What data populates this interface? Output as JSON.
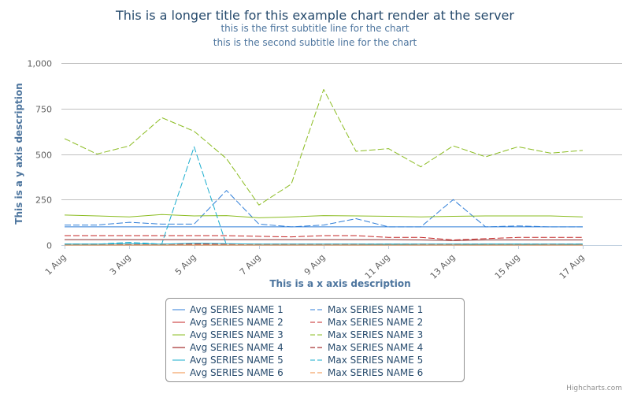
{
  "chart_data": {
    "type": "line",
    "title": "This is a longer title for this example chart render at the server",
    "subtitles": [
      "this is the first subtitle line for the chart",
      "this is the second subtitle line for the chart"
    ],
    "xlabel": "This is a x axis description",
    "ylabel": "This is a y axis description",
    "x": [
      "1 Aug",
      "2 Aug",
      "3 Aug",
      "4 Aug",
      "5 Aug",
      "6 Aug",
      "7 Aug",
      "8 Aug",
      "9 Aug",
      "10 Aug",
      "11 Aug",
      "12 Aug",
      "13 Aug",
      "14 Aug",
      "15 Aug",
      "16 Aug",
      "17 Aug"
    ],
    "x_tick_labels": [
      "1 Aug",
      "3 Aug",
      "5 Aug",
      "7 Aug",
      "9 Aug",
      "11 Aug",
      "13 Aug",
      "15 Aug",
      "17 Aug"
    ],
    "ylim": [
      0,
      1000
    ],
    "y_ticks": [
      0,
      250,
      500,
      750,
      1000
    ],
    "y_tick_labels": [
      "0",
      "250",
      "500",
      "750",
      "1,000"
    ],
    "grid": true,
    "legend_position": "bottom",
    "series": [
      {
        "name": "Avg SERIES NAME 1",
        "color": "#2f7ed8",
        "dash": false,
        "values": [
          100,
          100,
          100,
          100,
          100,
          100,
          100,
          100,
          100,
          100,
          100,
          100,
          100,
          100,
          100,
          100,
          100
        ]
      },
      {
        "name": "Max SERIES NAME 1",
        "color": "#2f7ed8",
        "dash": true,
        "values": [
          110,
          110,
          125,
          115,
          115,
          300,
          115,
          100,
          110,
          145,
          100,
          100,
          250,
          100,
          105,
          100,
          100
        ]
      },
      {
        "name": "Avg SERIES NAME 2",
        "color": "#8b2e2e",
        "dash": false,
        "values": [
          30,
          30,
          30,
          30,
          30,
          30,
          30,
          30,
          30,
          30,
          30,
          28,
          25,
          28,
          28,
          28,
          28
        ]
      },
      {
        "name": "Max SERIES NAME 2",
        "color": "#c42525",
        "dash": true,
        "values": [
          52,
          52,
          52,
          52,
          52,
          52,
          48,
          45,
          52,
          52,
          42,
          42,
          28,
          35,
          42,
          42,
          42
        ]
      },
      {
        "name": "Avg SERIES NAME 3",
        "color": "#8bbc21",
        "dash": false,
        "values": [
          165,
          160,
          155,
          168,
          160,
          162,
          150,
          155,
          162,
          160,
          158,
          155,
          158,
          160,
          160,
          160,
          155
        ]
      },
      {
        "name": "Max SERIES NAME 3",
        "color": "#8bbc21",
        "dash": true,
        "values": [
          585,
          500,
          545,
          700,
          625,
          475,
          220,
          335,
          855,
          515,
          530,
          430,
          545,
          485,
          540,
          505,
          520
        ]
      },
      {
        "name": "Avg SERIES NAME 4",
        "color": "#910000",
        "dash": false,
        "values": [
          0,
          0,
          0,
          0,
          0,
          0,
          0,
          0,
          0,
          0,
          0,
          0,
          0,
          0,
          0,
          0,
          0
        ]
      },
      {
        "name": "Max SERIES NAME 4",
        "color": "#910000",
        "dash": true,
        "values": [
          5,
          5,
          5,
          5,
          5,
          5,
          5,
          5,
          5,
          5,
          5,
          5,
          5,
          5,
          5,
          5,
          5
        ]
      },
      {
        "name": "Avg SERIES NAME 5",
        "color": "#1aadce",
        "dash": false,
        "values": [
          5,
          5,
          8,
          5,
          10,
          8,
          5,
          5,
          5,
          5,
          5,
          5,
          5,
          5,
          5,
          5,
          5
        ]
      },
      {
        "name": "Max SERIES NAME 5",
        "color": "#1aadce",
        "dash": true,
        "values": [
          5,
          5,
          15,
          5,
          540,
          0,
          0,
          0,
          0,
          0,
          5,
          0,
          0,
          5,
          5,
          0,
          5
        ]
      },
      {
        "name": "Avg SERIES NAME 6",
        "color": "#f28f43",
        "dash": false,
        "values": [
          0,
          0,
          0,
          0,
          0,
          0,
          0,
          0,
          0,
          0,
          0,
          0,
          0,
          0,
          0,
          0,
          0
        ]
      },
      {
        "name": "Max SERIES NAME 6",
        "color": "#f28f43",
        "dash": true,
        "values": [
          0,
          0,
          0,
          0,
          0,
          0,
          0,
          0,
          0,
          0,
          0,
          0,
          0,
          0,
          0,
          0,
          0
        ]
      }
    ],
    "legend_items": [
      {
        "name": "Avg SERIES NAME 1",
        "color": "#2f7ed8",
        "dash": false
      },
      {
        "name": "Max SERIES NAME 1",
        "color": "#2f7ed8",
        "dash": true
      },
      {
        "name": "Avg SERIES NAME 2",
        "color": "#c42525",
        "dash": false
      },
      {
        "name": "Max SERIES NAME 2",
        "color": "#c42525",
        "dash": true
      },
      {
        "name": "Avg SERIES NAME 3",
        "color": "#8bbc21",
        "dash": false
      },
      {
        "name": "Max SERIES NAME 3",
        "color": "#8bbc21",
        "dash": true
      },
      {
        "name": "Avg SERIES NAME 4",
        "color": "#910000",
        "dash": false
      },
      {
        "name": "Max SERIES NAME 4",
        "color": "#910000",
        "dash": true
      },
      {
        "name": "Avg SERIES NAME 5",
        "color": "#1aadce",
        "dash": false
      },
      {
        "name": "Max SERIES NAME 5",
        "color": "#1aadce",
        "dash": true
      },
      {
        "name": "Avg SERIES NAME 6",
        "color": "#f28f43",
        "dash": false
      },
      {
        "name": "Max SERIES NAME 6",
        "color": "#f28f43",
        "dash": true
      }
    ]
  },
  "credits": "Highcharts.com"
}
